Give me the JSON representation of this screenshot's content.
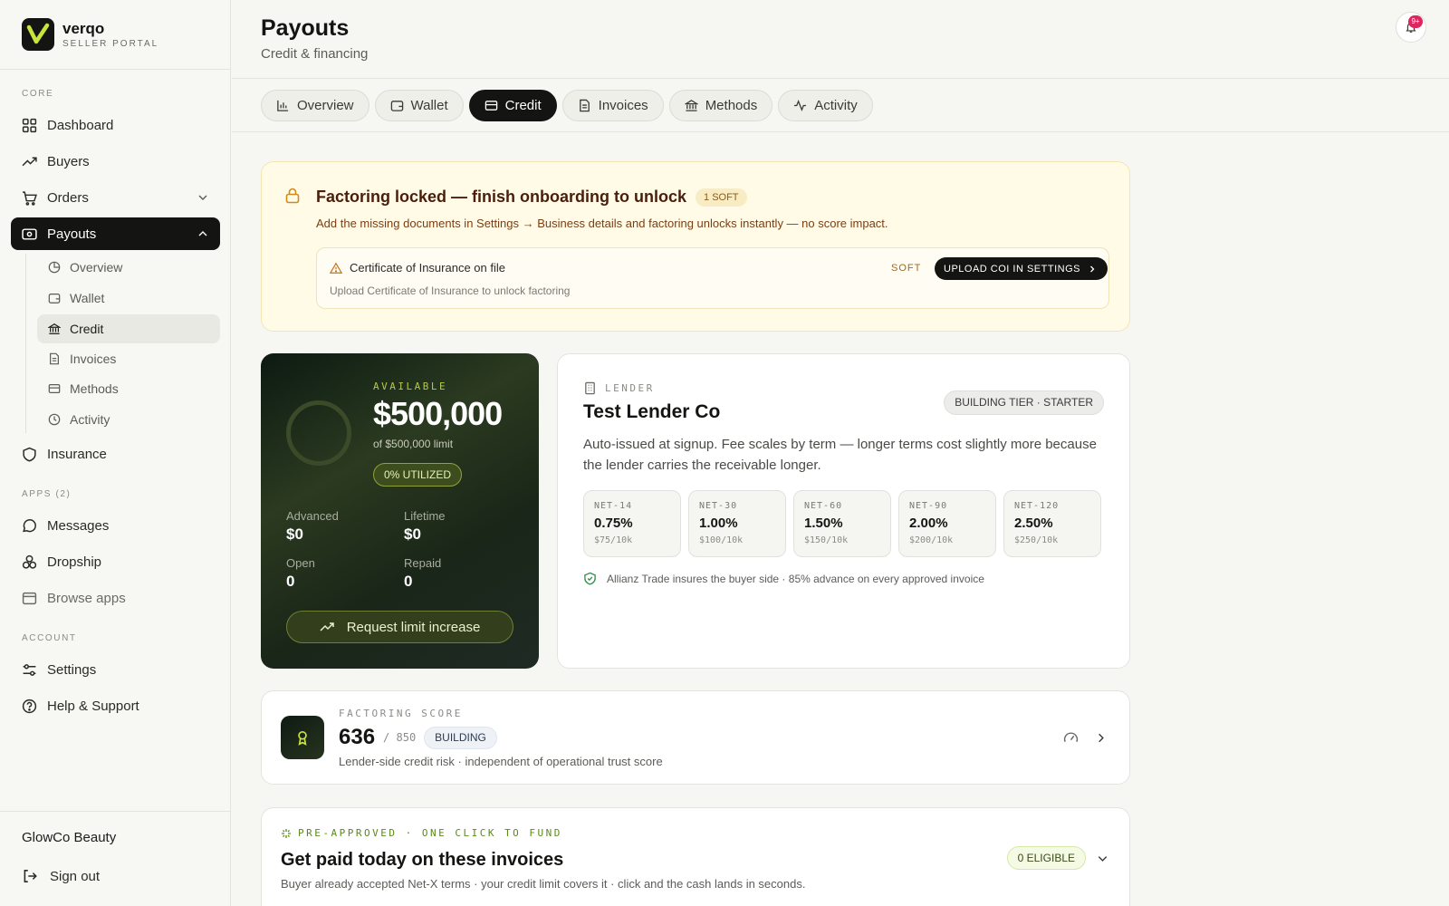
{
  "brand": {
    "name": "verqo",
    "subtitle": "SELLER PORTAL"
  },
  "sidebar": {
    "sections": {
      "core": "CORE",
      "apps": "APPS (2)",
      "account": "ACCOUNT"
    },
    "core_items": [
      {
        "label": "Dashboard",
        "icon": "grid-icon"
      },
      {
        "label": "Buyers",
        "icon": "trend-icon"
      },
      {
        "label": "Orders",
        "icon": "cart-icon"
      },
      {
        "label": "Payouts",
        "icon": "payouts-icon"
      }
    ],
    "payouts_sub": [
      {
        "label": "Overview",
        "icon": "pie-icon"
      },
      {
        "label": "Wallet",
        "icon": "wallet-icon"
      },
      {
        "label": "Credit",
        "icon": "bank-icon"
      },
      {
        "label": "Invoices",
        "icon": "file-icon"
      },
      {
        "label": "Methods",
        "icon": "card-icon"
      },
      {
        "label": "Activity",
        "icon": "clock-icon"
      }
    ],
    "insurance": "Insurance",
    "app_items": [
      {
        "label": "Messages",
        "icon": "chat-icon"
      },
      {
        "label": "Dropship",
        "icon": "boxes-icon"
      },
      {
        "label": "Browse apps",
        "icon": "browser-icon"
      }
    ],
    "account_items": [
      {
        "label": "Settings",
        "icon": "sliders-icon"
      },
      {
        "label": "Help & Support",
        "icon": "help-icon"
      }
    ],
    "company": "GlowCo Beauty",
    "signout": "Sign out"
  },
  "header": {
    "title": "Payouts",
    "subtitle": "Credit & financing",
    "notifications": "9+"
  },
  "tabs": [
    "Overview",
    "Wallet",
    "Credit",
    "Invoices",
    "Methods",
    "Activity"
  ],
  "active_tab": "Credit",
  "banner": {
    "title": "Factoring locked — finish onboarding to unlock",
    "pill": "1 SOFT",
    "description": "Add the missing documents in Settings → Business details and factoring unlocks instantly — no score impact.",
    "requirement": {
      "title": "Certificate of Insurance on file",
      "subtitle": "Upload Certificate of Insurance to unlock factoring",
      "severity": "SOFT",
      "button": "UPLOAD COI IN SETTINGS"
    }
  },
  "available": {
    "label": "AVAILABLE",
    "amount": "$500,000",
    "limit": "of $500,000 limit",
    "utilized": "0% UTILIZED",
    "utilization_fraction": 0,
    "stats": {
      "advanced_label": "Advanced",
      "advanced": "$0",
      "lifetime_label": "Lifetime",
      "lifetime": "$0",
      "open_label": "Open",
      "open": "0",
      "repaid_label": "Repaid",
      "repaid": "0"
    },
    "button": "Request limit increase"
  },
  "lender": {
    "label": "LENDER",
    "name": "Test Lender Co",
    "tier": "BUILDING TIER · STARTER",
    "description": "Auto-issued at signup. Fee scales by term — longer terms cost slightly more because the lender carries the receivable longer.",
    "terms": [
      {
        "name": "NET-14",
        "rate": "0.75%",
        "cost": "$75/10k"
      },
      {
        "name": "NET-30",
        "rate": "1.00%",
        "cost": "$100/10k"
      },
      {
        "name": "NET-60",
        "rate": "1.50%",
        "cost": "$150/10k"
      },
      {
        "name": "NET-90",
        "rate": "2.00%",
        "cost": "$200/10k"
      },
      {
        "name": "NET-120",
        "rate": "2.50%",
        "cost": "$250/10k"
      }
    ],
    "insurance_note": "Allianz Trade insures the buyer side · 85% advance on every approved invoice"
  },
  "score": {
    "label": "FACTORING SCORE",
    "value": "636",
    "max": "/ 850",
    "status": "BUILDING",
    "description": "Lender-side credit risk · independent of operational trust score"
  },
  "preapproved": {
    "label": "PRE-APPROVED · ONE CLICK TO FUND",
    "title": "Get paid today on these invoices",
    "description": "Buyer already accepted Net-X terms · your credit limit covers it · click and the cash lands in seconds.",
    "eligible": "0 ELIGIBLE"
  }
}
